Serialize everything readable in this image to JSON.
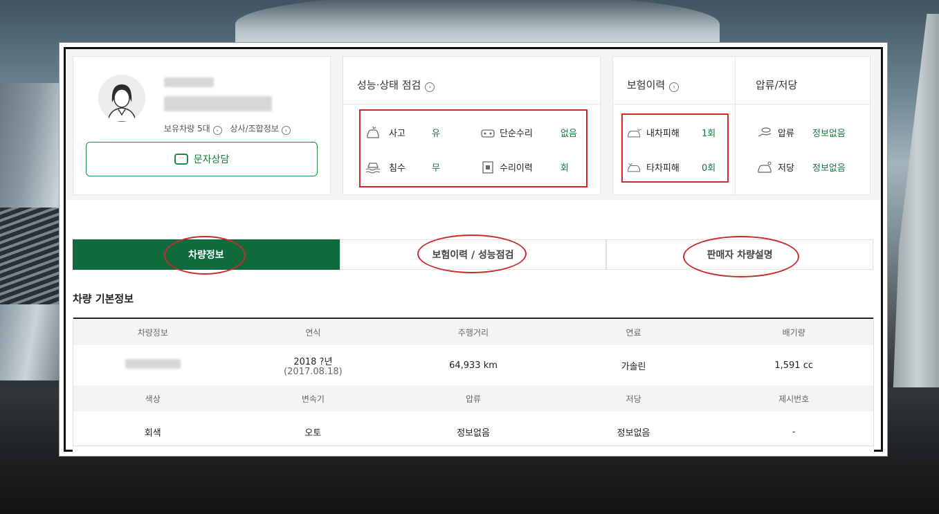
{
  "seller": {
    "cars_owned_link": "보유차량 5대",
    "shop_info_link": "상사/조합정보",
    "sms_button": "문자상담"
  },
  "inspection": {
    "title": "성능·상태 점검",
    "items": [
      {
        "label": "사고",
        "value": "유"
      },
      {
        "label": "단순수리",
        "value": "없음"
      },
      {
        "label": "침수",
        "value": "무"
      },
      {
        "label": "수리이력",
        "value": "회"
      }
    ]
  },
  "insurance": {
    "title": "보험이력",
    "items": [
      {
        "label": "내차피해",
        "value": "1회"
      },
      {
        "label": "타차피해",
        "value": "0회"
      }
    ]
  },
  "lien": {
    "title": "압류/저당",
    "items": [
      {
        "label": "압류",
        "value": "정보없음"
      },
      {
        "label": "저당",
        "value": "정보없음"
      }
    ]
  },
  "tabs": [
    "차량정보",
    "보험이력 / 성능점검",
    "판매자 차량설명"
  ],
  "section_title": "차량 기본정보",
  "spec_table": {
    "row1_headers": [
      "차량정보",
      "연식",
      "주행거리",
      "연료",
      "배기량"
    ],
    "row1_values": {
      "year": "2018 ?년",
      "year_sub": "(2017.08.18)",
      "mileage": "64,933 km",
      "fuel": "가솔린",
      "displacement": "1,591 cc"
    },
    "row2_headers": [
      "색상",
      "변속기",
      "압류",
      "저당",
      "제시번호"
    ],
    "row2_values": [
      "회색",
      "오토",
      "정보없음",
      "정보없음",
      "-"
    ]
  },
  "colors": {
    "accent_green": "#0f6b3e",
    "annotation_red": "#d42a2a"
  }
}
